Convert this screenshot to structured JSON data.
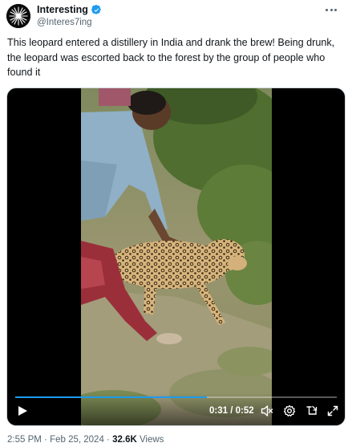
{
  "author": {
    "display_name": "Interesting",
    "handle": "@Interes7ing",
    "verified": true,
    "avatar_icon": "star-burst-logo-icon"
  },
  "tweet": {
    "text": "This leopard entered a distillery in India and drank the brew! Being drunk, the leopard was escorted back to the forest by the group of people who found it"
  },
  "video": {
    "current_time": "0:31",
    "duration": "0:52",
    "time_display": "0:31 / 0:52",
    "progress": 0.596,
    "controls": [
      "play-icon",
      "volume-muted-icon",
      "settings-gear-icon",
      "pip-icon",
      "fullscreen-icon"
    ]
  },
  "meta": {
    "time": "2:55 PM",
    "separator": " · ",
    "date": "Feb 25, 2024",
    "views_count": "32.6K",
    "views_label": "Views"
  },
  "colors": {
    "accent": "#1d9bf0",
    "text": "#0f1419",
    "secondary": "#536471"
  }
}
